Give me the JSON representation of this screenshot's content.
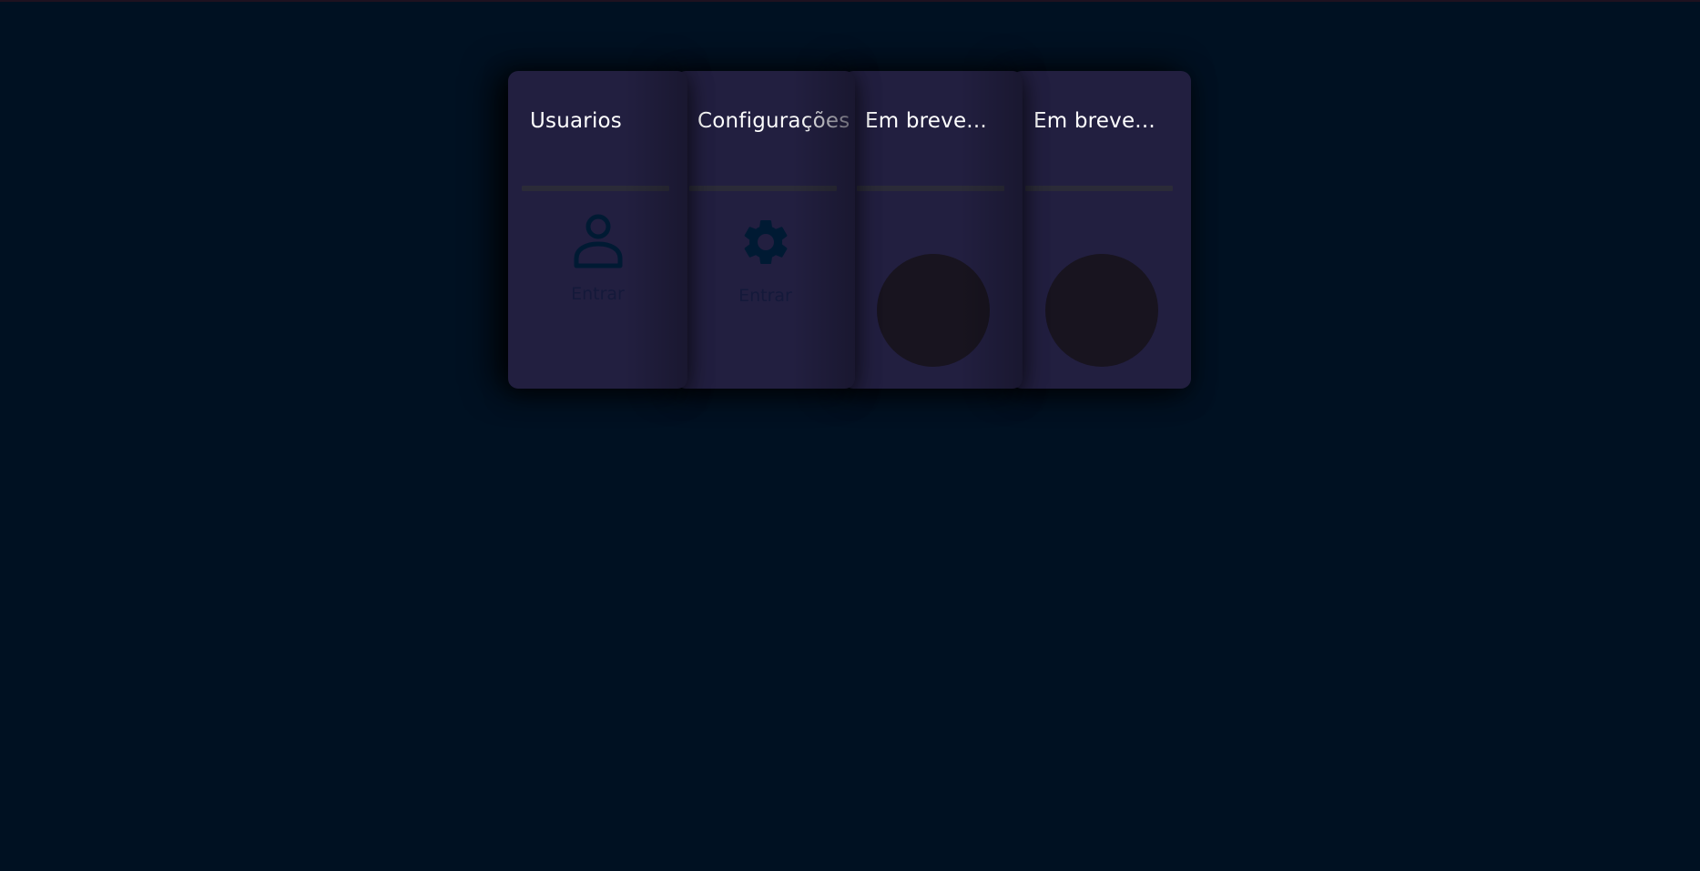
{
  "cards": [
    {
      "title": "Usuarios",
      "icon": "user-icon",
      "action": "Entrar"
    },
    {
      "title": "Configurações",
      "icon": "gear-icon",
      "action": "Entrar"
    },
    {
      "title": "Em breve...",
      "icon": "placeholder-circle"
    },
    {
      "title": "Em breve...",
      "icon": "placeholder-circle"
    }
  ],
  "colors": {
    "background": "#001122",
    "card": "#221f40",
    "icon": "#001a33",
    "placeholder": "#18141f"
  }
}
